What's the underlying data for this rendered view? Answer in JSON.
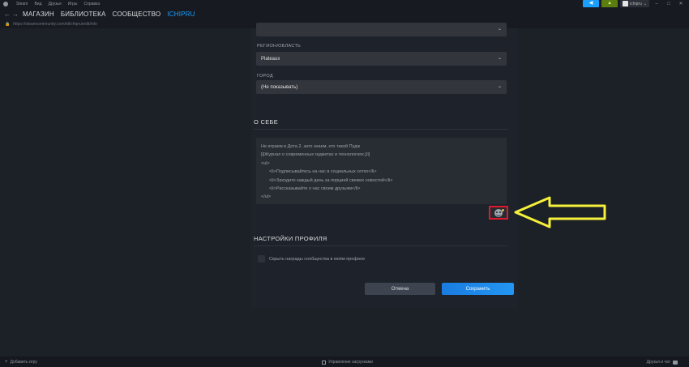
{
  "menu": {
    "items": [
      "Steam",
      "Вид",
      "Друзья",
      "Игры",
      "Справка"
    ]
  },
  "topright": {
    "username": "ichipru"
  },
  "nav": {
    "links": [
      "МАГАЗИН",
      "БИБЛИОТЕКА",
      "СООБЩЕСТВО",
      "ICHIPRU"
    ]
  },
  "urlbar": {
    "url": "https://steamcommunity.com/id/ichipru/edit/info"
  },
  "form": {
    "region_label": "РЕГИОН/ОБЛАСТЬ",
    "region_value": "Plateaux",
    "city_label": "ГОРОД",
    "city_value": "(Не показывать)"
  },
  "about": {
    "title": "О СЕБЕ",
    "lines": [
      "Не играем в Дота 2, зато знаем, кто такой Пудж",
      "[i]Журнал о современных гаджетах и технологиях.[/i]",
      "<ul>",
      "<li>Подписывайтесь на нас в социальных сетях</li>",
      "<li>Заходите каждый день за порцией свежих новостей</li>",
      "<li>Рассказывайте о нас своим друзьям</li>",
      "</ul>"
    ]
  },
  "profile_settings": {
    "title": "НАСТРОЙКИ ПРОФИЛЯ",
    "checkbox_label": "Скрыть награды сообщества в моём профиле"
  },
  "actions": {
    "cancel": "Отмена",
    "save": "Сохранить"
  },
  "bottombar": {
    "add_game": "Добавить игру",
    "downloads": "Управление загрузками",
    "friends": "Друзья и чат"
  },
  "colors": {
    "accent": "#1a9fff",
    "highlight_box": "#e0192d",
    "arrow": "#f5f03a"
  }
}
